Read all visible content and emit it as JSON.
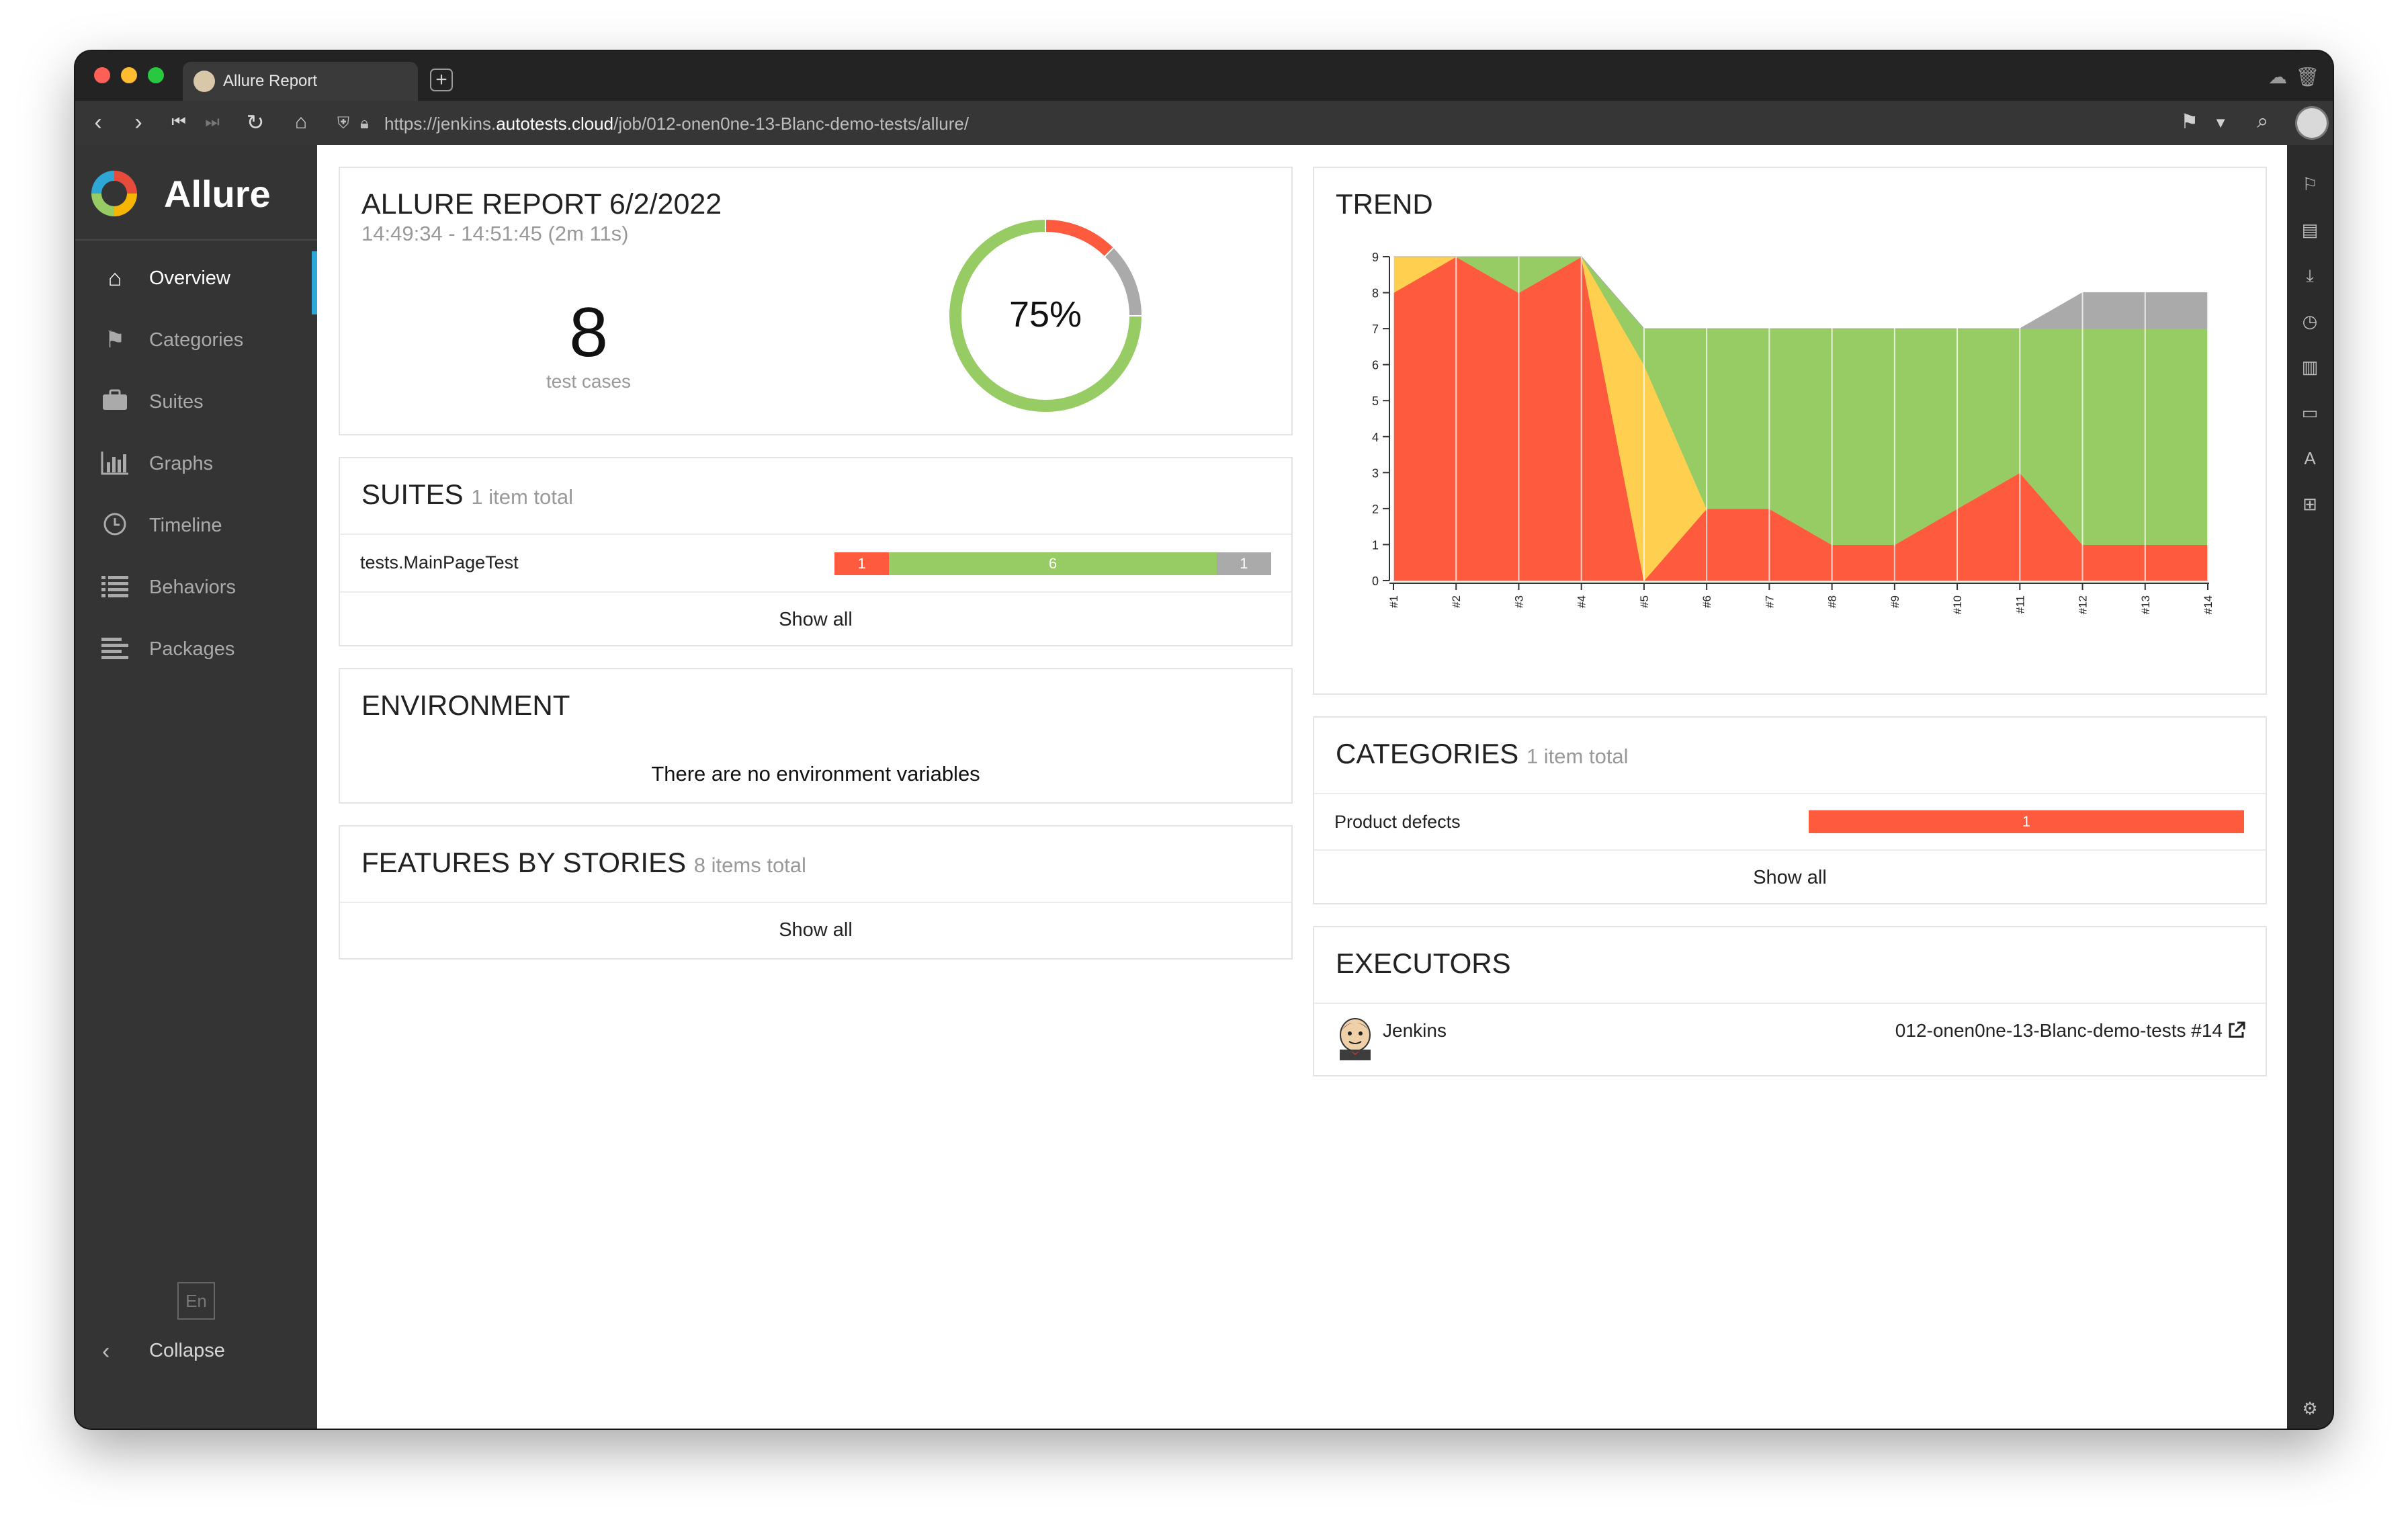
{
  "browser": {
    "tab_title": "Allure Report",
    "url_prefix": "https://jenkins.",
    "url_domain": "autotests.cloud",
    "url_path": "/job/012-onen0ne-13-Blanc-demo-tests/allure/"
  },
  "sidebar": {
    "brand": "Allure",
    "items": [
      {
        "label": "Overview",
        "icon": "home-icon",
        "active": true
      },
      {
        "label": "Categories",
        "icon": "flag-icon"
      },
      {
        "label": "Suites",
        "icon": "briefcase-icon"
      },
      {
        "label": "Graphs",
        "icon": "bar-chart-icon"
      },
      {
        "label": "Timeline",
        "icon": "clock-icon"
      },
      {
        "label": "Behaviors",
        "icon": "list-icon"
      },
      {
        "label": "Packages",
        "icon": "align-left-icon"
      }
    ],
    "language": "En",
    "collapse_label": "Collapse"
  },
  "report": {
    "title": "ALLURE REPORT 6/2/2022",
    "time_range": "14:49:34 - 14:51:45 (2m 11s)",
    "test_count": "8",
    "test_count_label": "test cases",
    "pass_percent": "75%",
    "donut": [
      {
        "status": "passed",
        "count": 6,
        "color": "#97cc64"
      },
      {
        "status": "failed",
        "count": 1,
        "color": "#fd5a3e"
      },
      {
        "status": "unknown",
        "count": 1,
        "color": "#aaaaaa"
      }
    ]
  },
  "suites": {
    "title": "SUITES",
    "subtitle": "1 item total",
    "rows": [
      {
        "name": "tests.MainPageTest",
        "segments": [
          {
            "label": "1",
            "value": 1,
            "color": "#fd5a3e"
          },
          {
            "label": "6",
            "value": 6,
            "color": "#97cc64"
          },
          {
            "label": "1",
            "value": 1,
            "color": "#aaaaaa"
          }
        ]
      }
    ],
    "show_all": "Show all"
  },
  "environment": {
    "title": "ENVIRONMENT",
    "message": "There are no environment variables"
  },
  "features": {
    "title": "FEATURES BY STORIES",
    "subtitle": "8 items total",
    "show_all": "Show all"
  },
  "chart_data": {
    "type": "area",
    "title": "TREND",
    "x": [
      "#1",
      "#2",
      "#3",
      "#4",
      "#5",
      "#6",
      "#7",
      "#8",
      "#9",
      "#10",
      "#11",
      "#12",
      "#13",
      "#14"
    ],
    "ylim": [
      0,
      9
    ],
    "yticks": [
      "0",
      "1",
      "2",
      "3",
      "4",
      "5",
      "6",
      "7",
      "8",
      "9"
    ],
    "stacked": true,
    "series": [
      {
        "status": "failed",
        "color": "#fd5a3e",
        "values": [
          8,
          9,
          8,
          9,
          0,
          2,
          2,
          1,
          1,
          2,
          3,
          1,
          1,
          1
        ]
      },
      {
        "status": "broken",
        "color": "#ffd050",
        "values": [
          1,
          0,
          0,
          0,
          6,
          0,
          0,
          0,
          0,
          0,
          0,
          0,
          0,
          0
        ]
      },
      {
        "status": "passed",
        "color": "#97cc64",
        "values": [
          0,
          0,
          1,
          0,
          1,
          5,
          5,
          6,
          6,
          5,
          4,
          6,
          6,
          6
        ]
      },
      {
        "status": "unknown",
        "color": "#aaaaaa",
        "values": [
          0,
          0,
          0,
          0,
          0,
          0,
          0,
          0,
          0,
          0,
          0,
          1,
          1,
          1
        ]
      }
    ],
    "grid": true
  },
  "categories": {
    "title": "CATEGORIES",
    "subtitle": "1 item total",
    "rows": [
      {
        "name": "Product defects",
        "label": "1",
        "value": 1,
        "color": "#fd5a3e"
      }
    ],
    "show_all": "Show all"
  },
  "executors": {
    "title": "EXECUTORS",
    "name": "Jenkins",
    "build": "012-onen0ne-13-Blanc-demo-tests #14",
    "link_icon": "external-link-icon"
  }
}
